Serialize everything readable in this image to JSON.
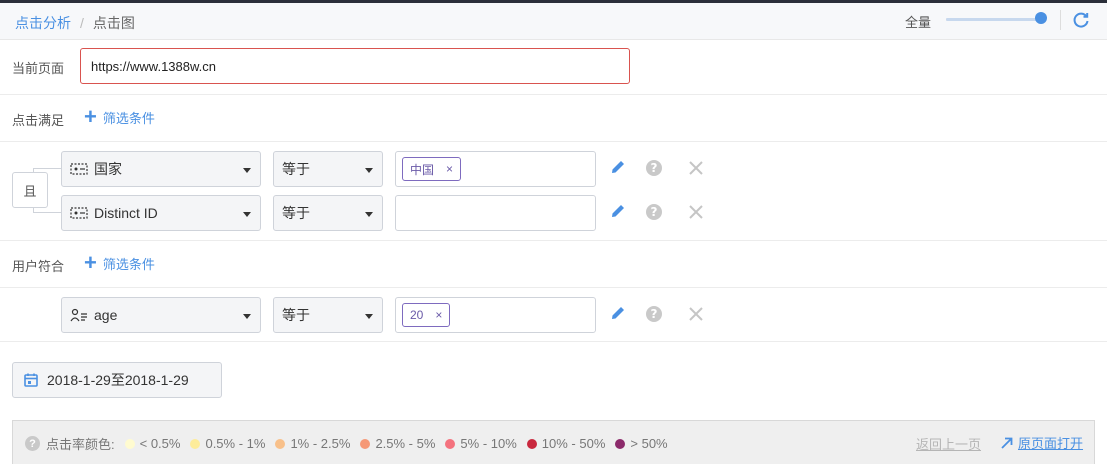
{
  "breadcrumb": {
    "parent": "点击分析",
    "separator": "/",
    "current": "点击图"
  },
  "header": {
    "zoom_label": "全量",
    "zoom_level": 1.0
  },
  "current_page": {
    "label": "当前页面",
    "url": "https://www.1388w.cn"
  },
  "click_filter": {
    "label": "点击满足",
    "add_label": "筛选条件",
    "logic": "且",
    "conditions": [
      {
        "field": "国家",
        "operator": "等于",
        "values": [
          "中国"
        ],
        "value_text": "中国"
      },
      {
        "field": "Distinct ID",
        "operator": "等于",
        "values": []
      }
    ]
  },
  "user_filter": {
    "label": "用户符合",
    "add_label": "筛选条件",
    "conditions": [
      {
        "field": "age",
        "operator": "等于",
        "values": [
          "20"
        ],
        "value_text": "20"
      }
    ]
  },
  "date_range": "2018-1-29至2018-1-29",
  "legend": {
    "label": "点击率颜色:",
    "items": [
      {
        "label": "< 0.5%",
        "color": "#fffbd0"
      },
      {
        "label": "0.5% - 1%",
        "color": "#fdec9a"
      },
      {
        "label": "1% - 2.5%",
        "color": "#f8c08a"
      },
      {
        "label": "2.5% - 5%",
        "color": "#f59876"
      },
      {
        "label": "5% - 10%",
        "color": "#f4727e"
      },
      {
        "label": "10% - 50%",
        "color": "#c9283e"
      },
      {
        "label": "> 50%",
        "color": "#8c2a6b"
      }
    ],
    "back_label": "返回上一页",
    "open_label": "原页面打开"
  },
  "colors": {
    "accent": "#4a90e2",
    "error_border": "#d9534f",
    "tag": "#6a5aa8"
  }
}
